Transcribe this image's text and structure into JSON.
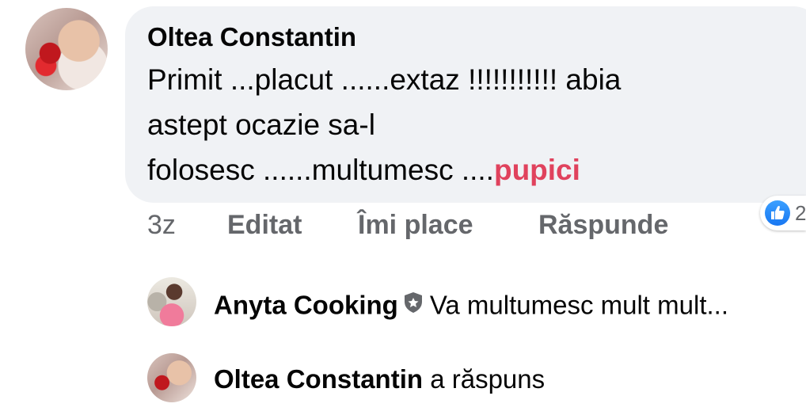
{
  "comment": {
    "author": "Oltea Constantin",
    "line1": "Primit ...placut ......extaz !!!!!!!!!!! abia",
    "line2": "astept ocazie sa-l",
    "line3_text": "folosesc ......multumesc ....",
    "line3_tag": "pupici"
  },
  "reaction": {
    "icon": "like-icon",
    "count": "2",
    "color": "#1877f2"
  },
  "actions": {
    "time": "3z",
    "edited": "Editat",
    "like": "Îmi place",
    "reply": "Răspunde"
  },
  "replies": [
    {
      "author": "Anyta Cooking",
      "badge_icon": "top-fan-shield-icon",
      "text": "Va multumesc mult mult..."
    },
    {
      "author": "Oltea Constantin",
      "text": "a răspuns"
    }
  ],
  "colors": {
    "bubble": "#f0f2f5",
    "secondary_text": "#65676b",
    "tag": "#e0425d"
  }
}
